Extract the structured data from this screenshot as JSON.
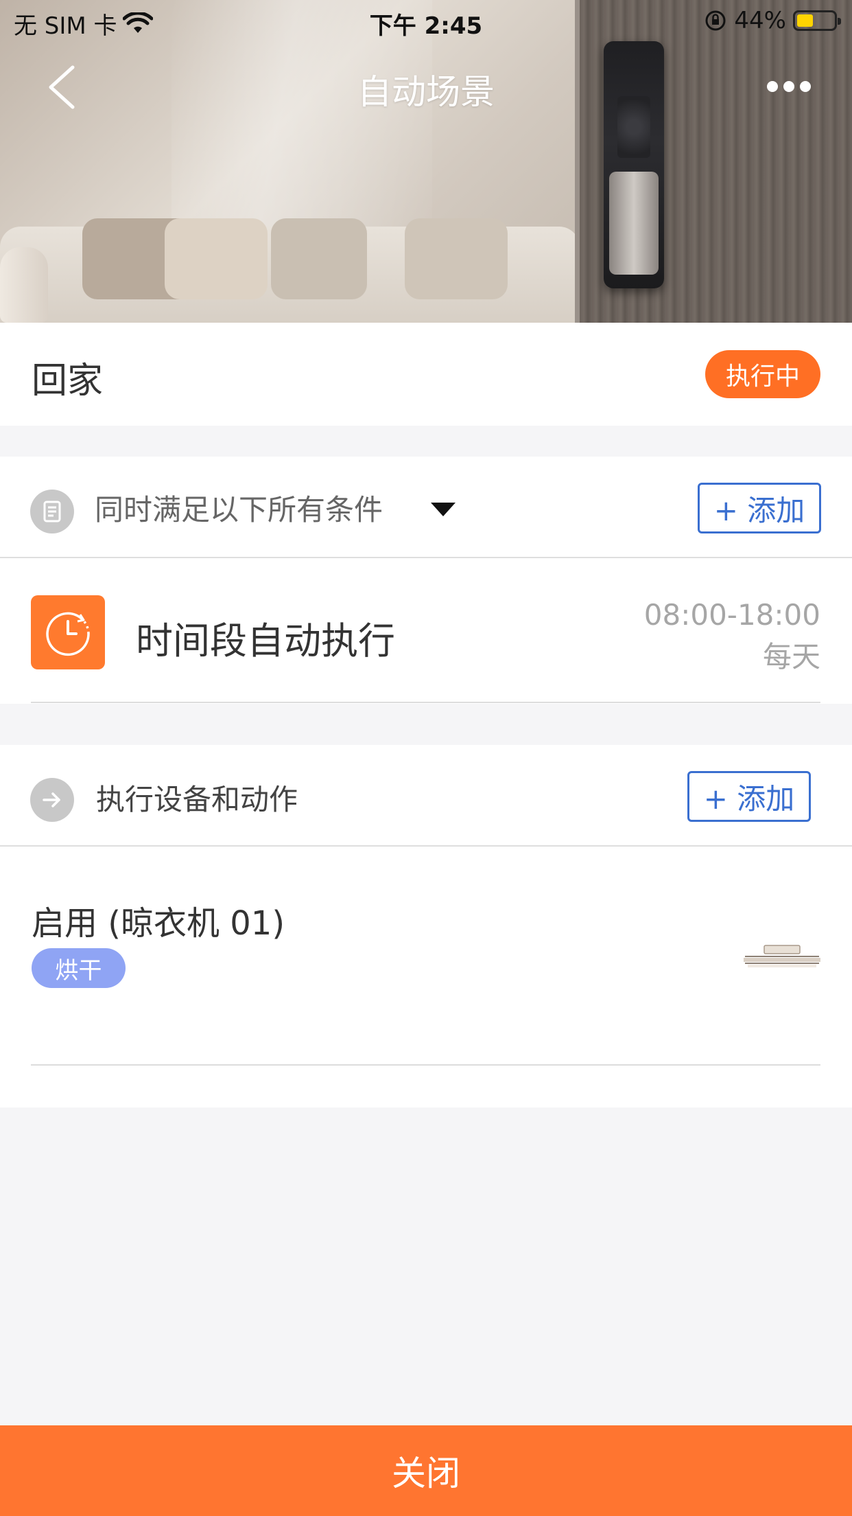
{
  "status_bar": {
    "carrier": "无 SIM 卡",
    "time": "下午 2:45",
    "battery": "44%",
    "battery_level": 0.44
  },
  "nav": {
    "title": "自动场景",
    "back_icon": "chevron-left-icon",
    "more_icon": "more-dots-icon"
  },
  "scene": {
    "name": "回家",
    "status": "执行中",
    "status_color": "#ff6f24"
  },
  "conditions": {
    "title": "同时满足以下所有条件",
    "add_label": "+ 添加",
    "items": [
      {
        "title": "时间段自动执行",
        "time": "08:00-18:00",
        "repeat": "每天",
        "icon": "clock-icon"
      }
    ]
  },
  "actions": {
    "title": "执行设备和动作",
    "add_label": "+ 添加",
    "items": [
      {
        "title": "启用 (晾衣机 01)",
        "tag": "烘干",
        "thumb": "clothes-dryer-thumbnail"
      }
    ]
  },
  "footer": {
    "close_label": "关闭",
    "accent": "#ff7530"
  },
  "colors": {
    "link_blue": "#3a6fd0",
    "tag_blue": "#8fa4f4",
    "orange": "#ff7a2e"
  }
}
